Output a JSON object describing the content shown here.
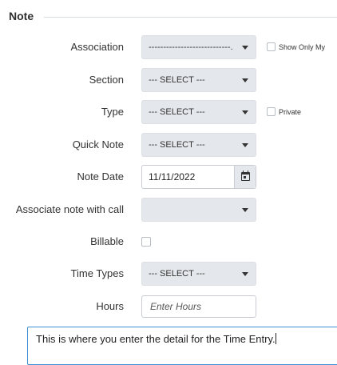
{
  "section": {
    "title": "Note"
  },
  "form": {
    "association": {
      "label": "Association",
      "value": "----------------------------.",
      "show_only_my_label": "Show Only My"
    },
    "section": {
      "label": "Section",
      "value": "--- SELECT ---"
    },
    "type": {
      "label": "Type",
      "value": "--- SELECT ---",
      "private_label": "Private"
    },
    "quick_note": {
      "label": "Quick Note",
      "value": "--- SELECT ---"
    },
    "note_date": {
      "label": "Note Date",
      "value": "11/11/2022"
    },
    "associate_call": {
      "label": "Associate note with call",
      "value": ""
    },
    "billable": {
      "label": "Billable"
    },
    "time_types": {
      "label": "Time Types",
      "value": "--- SELECT ---"
    },
    "hours": {
      "label": "Hours",
      "placeholder": "Enter Hours"
    },
    "detail": {
      "value": "This is where you enter the detail for the Time Entry."
    }
  }
}
